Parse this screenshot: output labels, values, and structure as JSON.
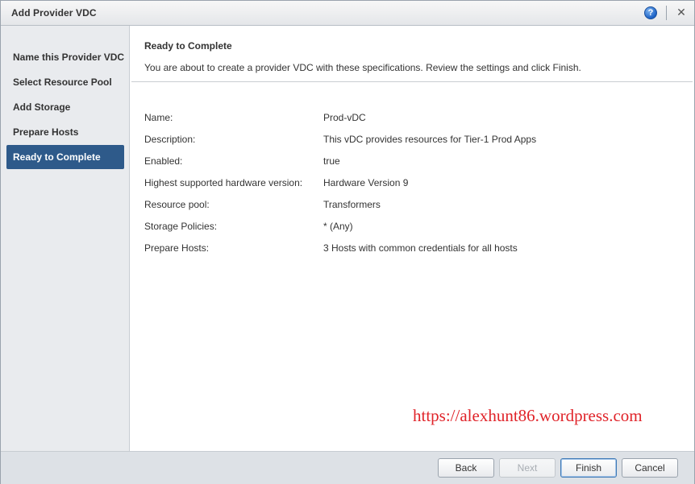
{
  "window": {
    "title": "Add Provider VDC",
    "help_glyph": "?",
    "close_glyph": "✕",
    "icons": [
      "help-icon",
      "close-icon"
    ]
  },
  "steps": [
    {
      "label": "Name this Provider VDC",
      "active": false
    },
    {
      "label": "Select Resource Pool",
      "active": false
    },
    {
      "label": "Add Storage",
      "active": false
    },
    {
      "label": "Prepare Hosts",
      "active": false
    },
    {
      "label": "Ready to Complete",
      "active": true
    }
  ],
  "main": {
    "title": "Ready to Complete",
    "description": "You are about to create a provider VDC with these specifications. Review the settings and click Finish.",
    "summary": [
      {
        "label": "Name:",
        "value": "Prod-vDC"
      },
      {
        "label": "Description:",
        "value": "This vDC provides resources for Tier-1 Prod Apps"
      },
      {
        "label": "Enabled:",
        "value": "true"
      },
      {
        "label": "Highest supported hardware version:",
        "value": "Hardware Version 9"
      },
      {
        "label": "Resource pool:",
        "value": "Transformers"
      },
      {
        "label": "Storage Policies:",
        "value": "* (Any)"
      },
      {
        "label": "Prepare Hosts:",
        "value": "3 Hosts with common credentials for all hosts"
      }
    ]
  },
  "watermark": "https://alexhunt86.wordpress.com",
  "buttons": {
    "back": "Back",
    "next": "Next",
    "finish": "Finish",
    "cancel": "Cancel"
  },
  "colors": {
    "active_step": "#2e5a8a",
    "watermark": "#e0242a",
    "help_icon": "#1d63c6"
  }
}
